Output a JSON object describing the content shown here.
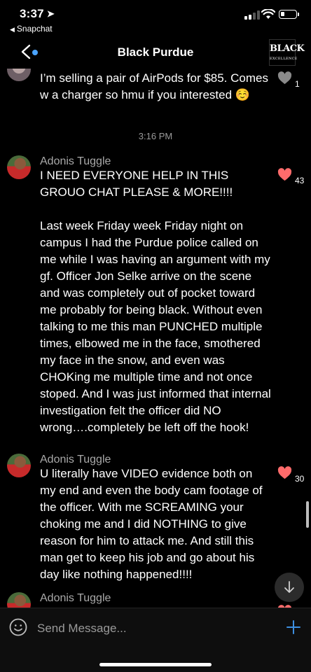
{
  "status_bar": {
    "time": "3:37",
    "back_app": "Snapchat",
    "battery_level": 0.28
  },
  "nav": {
    "title": "Black Purdue",
    "logo_line1": "BLACK",
    "logo_line2": "EXCELLENCE"
  },
  "messages": [
    {
      "sender": "",
      "text": "I’m selling a pair of AirPods for $85. Comes w a charger so hmu if you interested ☺️",
      "likes": "1",
      "liked": false
    },
    {
      "sender": "Adonis Tuggle",
      "text": "I NEED EVERYONE HELP IN THIS GROUO CHAT PLEASE & MORE!!!!\n\nLast week Friday week Friday night on campus I had the Purdue police called on me while I was having an argument with my gf. Officer Jon Selke arrive on the scene and was completely out of pocket toward me probably for being black. Without even talking to me this man PUNCHED multiple times, elbowed me in the face, smothered my face in the snow, and even was CHOKing me multiple time and not once stoped. And I was just informed that internal investigation felt the officer did NO wrong….completely be left off the hook!",
      "likes": "43",
      "liked": true
    },
    {
      "sender": "Adonis Tuggle",
      "text": "U literally have VIDEO evidence both on my end and even the body cam footage of the officer. With me SCREAMING your choking me and I did NOTHING to give reason for him to attack me. And still this man get to keep his job and go about his day like nothing happened!!!!",
      "likes": "30",
      "liked": true
    },
    {
      "sender": "Adonis Tuggle",
      "text": "",
      "likes": "",
      "liked": true
    }
  ],
  "timestamp": "3:16 PM",
  "composer": {
    "placeholder": "Send Message..."
  },
  "icons": {
    "location": "location-arrow-icon",
    "back": "chevron-left-icon",
    "like": "heart-icon",
    "emoji": "smiley-icon",
    "add": "plus-icon",
    "scroll": "arrow-down-icon"
  },
  "colors": {
    "background": "#000000",
    "like_active": "#ff6b6b",
    "like_inactive": "#8a8a8a",
    "accent": "#3d8fe0",
    "unread_dot": "#4aa3ff"
  }
}
